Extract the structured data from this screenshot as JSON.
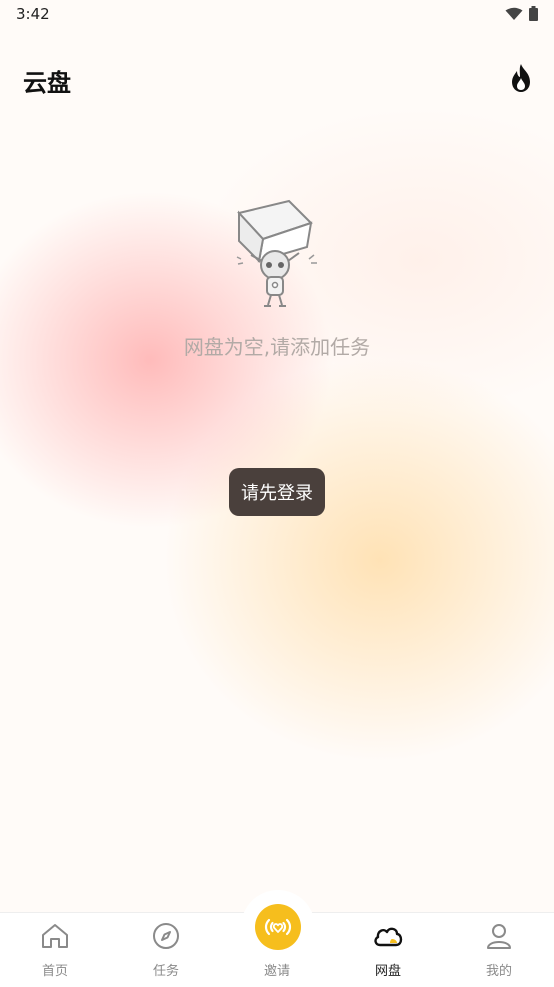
{
  "status_bar": {
    "time": "3:42"
  },
  "header": {
    "title": "云盘"
  },
  "empty_state": {
    "message": "网盘为空,请添加任务"
  },
  "toast": {
    "text": "请先登录"
  },
  "tabbar": {
    "items": [
      {
        "label": "首页",
        "icon": "home-icon"
      },
      {
        "label": "任务",
        "icon": "compass-icon"
      },
      {
        "label": "邀请",
        "icon": "broadcast-heart-icon"
      },
      {
        "label": "网盘",
        "icon": "cloud-icon",
        "active": true
      },
      {
        "label": "我的",
        "icon": "user-icon"
      }
    ]
  },
  "colors": {
    "accent": "#f6be1d",
    "toast_bg": "#4a403c"
  }
}
